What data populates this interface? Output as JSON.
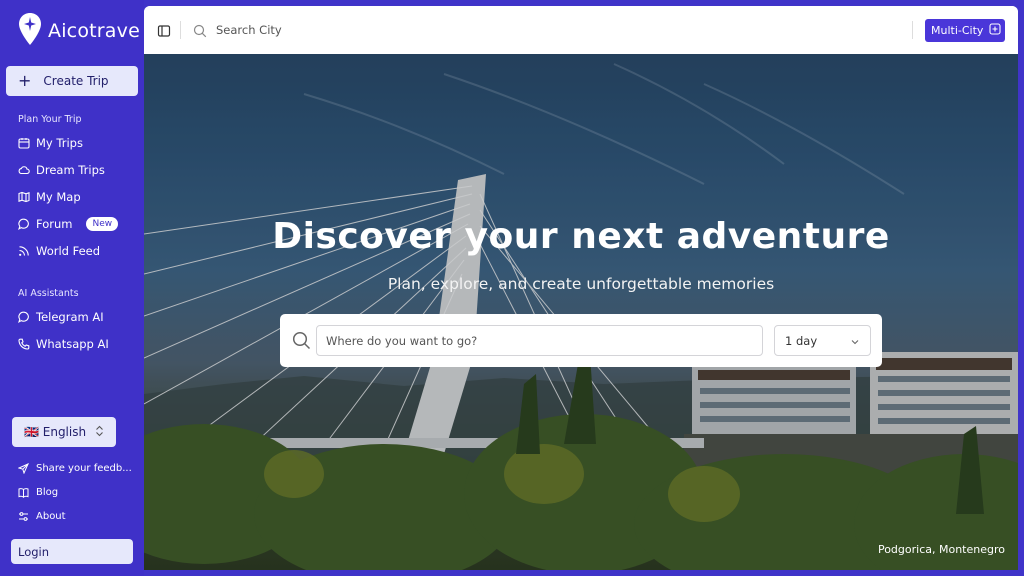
{
  "brand": {
    "name": "Aicotrave"
  },
  "sidebar": {
    "create_trip": "Create Trip",
    "section_plan": "Plan Your Trip",
    "plan_items": [
      {
        "label": "My Trips",
        "icon": "calendar-icon"
      },
      {
        "label": "Dream Trips",
        "icon": "cloud-icon"
      },
      {
        "label": "My Map",
        "icon": "map-icon"
      },
      {
        "label": "Forum",
        "icon": "chat-bubble-icon",
        "badge": "New"
      },
      {
        "label": "World Feed",
        "icon": "rss-icon"
      }
    ],
    "section_ai": "AI Assistants",
    "ai_items": [
      {
        "label": "Telegram AI",
        "icon": "chat-bubble-icon"
      },
      {
        "label": "Whatsapp AI",
        "icon": "phone-icon"
      }
    ],
    "language": "🇬🇧 English",
    "footer_items": [
      {
        "label": "Share your feedb...",
        "icon": "send-icon"
      },
      {
        "label": "Blog",
        "icon": "book-icon"
      },
      {
        "label": "About",
        "icon": "sliders-icon"
      }
    ],
    "login": "Login"
  },
  "topbar": {
    "search_placeholder": "Search City",
    "multi_city": "Multi-City"
  },
  "hero": {
    "title": "Discover your next adventure",
    "subtitle": "Plan, explore, and create unforgettable memories",
    "destination_placeholder": "Where do you want to go?",
    "duration": "1 day",
    "caption": "Podgorica, Montenegro"
  },
  "colors": {
    "sidebar_bg": "#3f31c8",
    "accent": "#4a36d9",
    "light_button": "#e6e8fb"
  }
}
